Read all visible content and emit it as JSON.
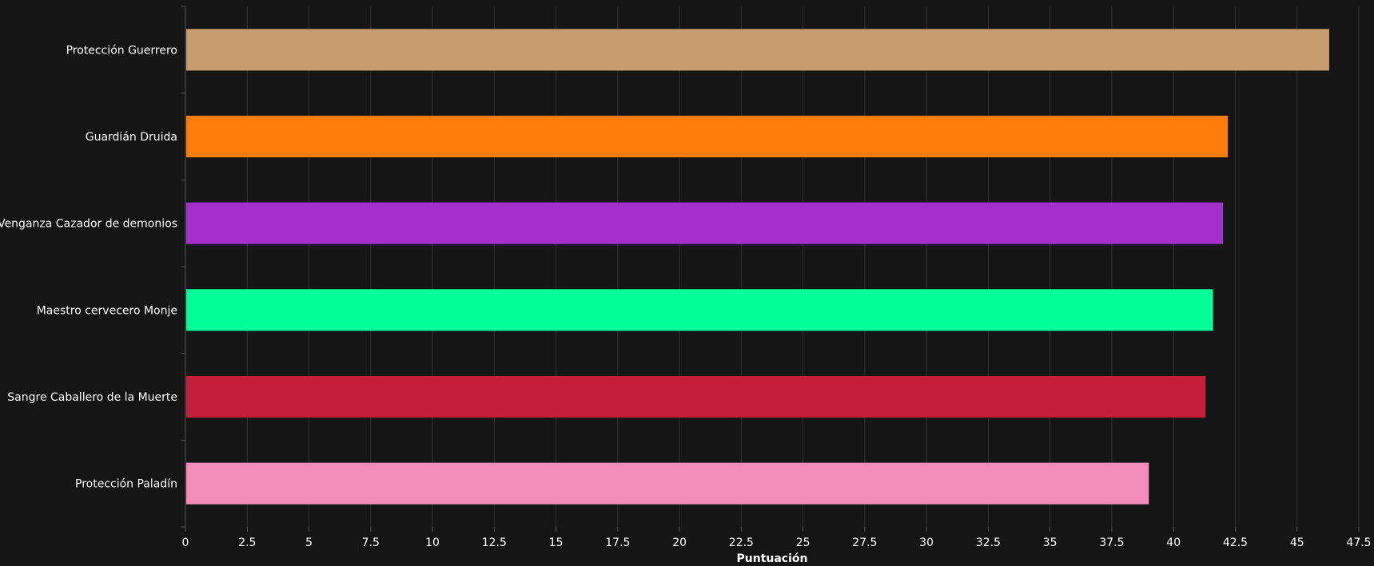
{
  "chart_data": {
    "type": "bar",
    "orientation": "horizontal",
    "categories": [
      "Protección Guerrero",
      "Guardián Druida",
      "Venganza Cazador de demonios",
      "Maestro cervecero Monje",
      "Sangre Caballero de la Muerte",
      "Protección Paladín"
    ],
    "values": [
      46.3,
      42.2,
      42.0,
      41.6,
      41.3,
      39.0
    ],
    "colors": [
      "#C69B6D",
      "#FF7C0A",
      "#A330C9",
      "#00FF98",
      "#C41E3A",
      "#F48CBA"
    ],
    "xlabel": "Puntuación",
    "ylabel": "",
    "title": "",
    "xlim": [
      0,
      47.5
    ],
    "x_ticks": [
      0,
      2.5,
      5,
      7.5,
      10,
      12.5,
      15,
      17.5,
      20,
      22.5,
      25,
      27.5,
      30,
      32.5,
      35,
      37.5,
      40,
      42.5,
      45,
      47.5
    ],
    "grid": "vertical",
    "background": "#151515",
    "grid_color": "#333333"
  }
}
